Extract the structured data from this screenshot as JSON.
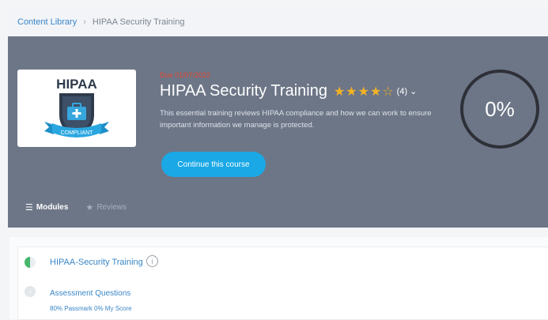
{
  "breadcrumb": {
    "root": "Content Library",
    "current": "HIPAA Security Training"
  },
  "course": {
    "due": "Due 01/07/2022",
    "title": "HIPAA Security Training",
    "rating_value": 4.5,
    "rating_count": "(4)",
    "description": "This essential training reviews HIPAA compliance and how we can work to ensure important information we manage is protected.",
    "continue_label": "Continue this course",
    "progress": "0%",
    "progress_value": 0
  },
  "logo": {
    "line1": "HIPAA",
    "banner": "COMPLIANT"
  },
  "tabs": [
    {
      "label": "Modules",
      "icon": "list-icon",
      "active": true
    },
    {
      "label": "Reviews",
      "icon": "star-icon",
      "active": false
    }
  ],
  "modules": [
    {
      "title": "HIPAA-Security Training",
      "status": "in-progress"
    },
    {
      "title": "Assessment Questions",
      "subtitle": "80% Passmark 0% My Score",
      "status": "not-started"
    }
  ],
  "colors": {
    "hero_bg": "#6d7687",
    "accent": "#1aa8e6",
    "link": "#3b86c6",
    "due": "#e0462f",
    "star": "#f3b323",
    "progress_dot": "#46b76a"
  }
}
